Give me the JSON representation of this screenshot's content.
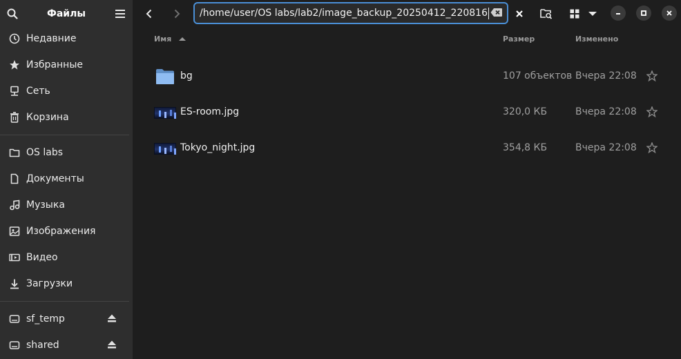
{
  "sidebar": {
    "title": "Файлы",
    "items": [
      {
        "label": "Недавние",
        "icon": "recent-icon"
      },
      {
        "label": "Избранные",
        "icon": "star-icon"
      },
      {
        "label": "Сеть",
        "icon": "network-icon"
      },
      {
        "label": "Корзина",
        "icon": "trash-icon"
      }
    ],
    "places": [
      {
        "label": "OS labs",
        "icon": "folder-icon"
      },
      {
        "label": "Документы",
        "icon": "document-icon"
      },
      {
        "label": "Музыка",
        "icon": "music-icon"
      },
      {
        "label": "Изображения",
        "icon": "image-icon"
      },
      {
        "label": "Видео",
        "icon": "video-icon"
      },
      {
        "label": "Загрузки",
        "icon": "download-icon"
      }
    ],
    "drives": [
      {
        "label": "sf_temp",
        "icon": "drive-icon"
      },
      {
        "label": "shared",
        "icon": "drive-icon"
      }
    ]
  },
  "toolbar": {
    "path": "/home/user/OS labs/lab2/image_backup_20250412_220816"
  },
  "columns": {
    "name": "Имя",
    "size": "Размер",
    "modified": "Изменено"
  },
  "files": [
    {
      "name": "bg",
      "size": "107 объектов",
      "modified": "Вчера 22:08",
      "type": "folder"
    },
    {
      "name": "ES-room.jpg",
      "size": "320,0 КБ",
      "modified": "Вчера 22:08",
      "type": "image"
    },
    {
      "name": "Tokyo_night.jpg",
      "size": "354,8 КБ",
      "modified": "Вчера 22:08",
      "type": "image"
    }
  ],
  "colors": {
    "accent": "#4a8fd6",
    "sidebar_bg": "#2e2e2e",
    "main_bg": "#1e1e1e",
    "folder": "#8fbcf2"
  }
}
